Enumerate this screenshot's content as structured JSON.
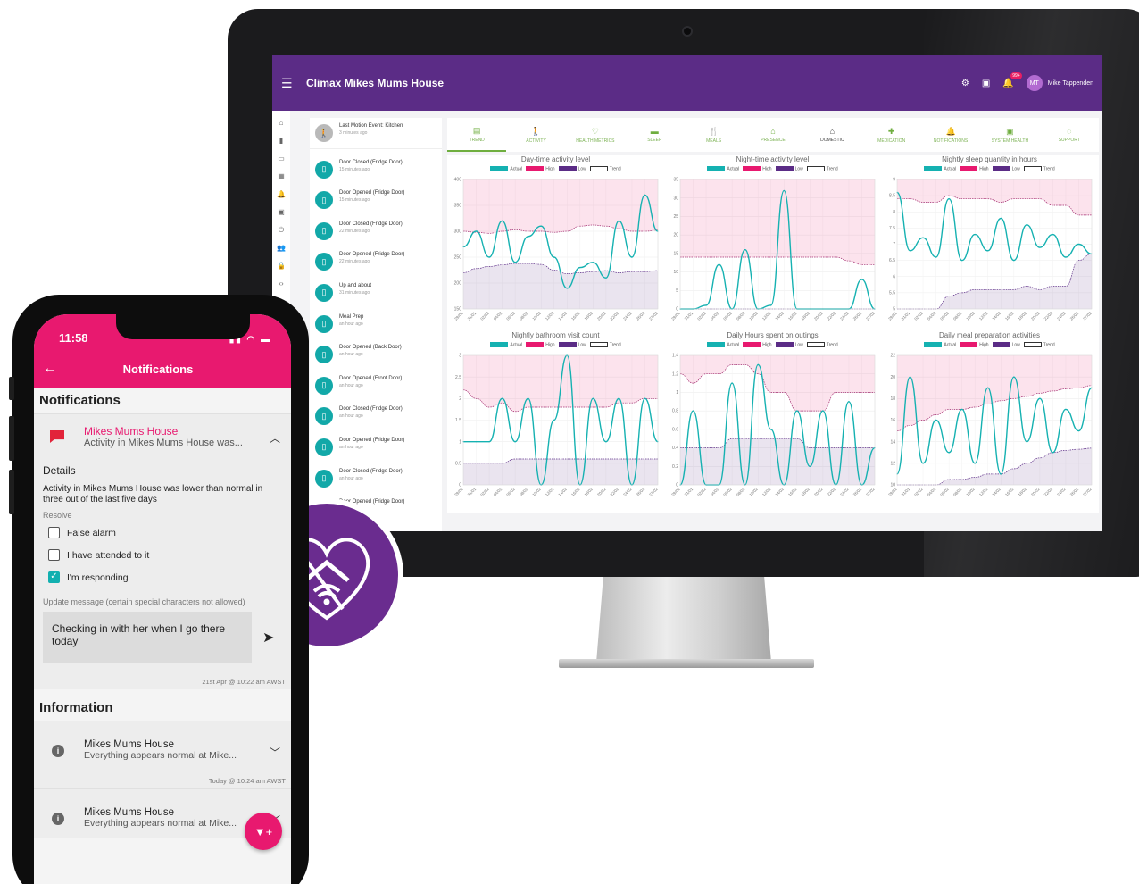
{
  "dashboard": {
    "app_title": "Climax Mikes Mums House",
    "notif_badge": "99+",
    "user_initials": "MT",
    "user_name": "Mike Tappenden",
    "events": [
      {
        "label": "Last Motion Event: Kitchen",
        "time": "3 minutes ago"
      },
      {
        "label": "Door Closed (Fridge Door)",
        "time": "15 minutes ago"
      },
      {
        "label": "Door Opened (Fridge Door)",
        "time": "15 minutes ago"
      },
      {
        "label": "Door Closed (Fridge Door)",
        "time": "22 minutes ago"
      },
      {
        "label": "Door Opened (Fridge Door)",
        "time": "22 minutes ago"
      },
      {
        "label": "Up and about",
        "time": "31 minutes ago"
      },
      {
        "label": "Meal Prep",
        "time": "an hour ago"
      },
      {
        "label": "Door Opened (Back Door)",
        "time": "an hour ago"
      },
      {
        "label": "Door Opened (Front Door)",
        "time": "an hour ago"
      },
      {
        "label": "Door Closed (Fridge Door)",
        "time": "an hour ago"
      },
      {
        "label": "Door Opened (Fridge Door)",
        "time": "an hour ago"
      },
      {
        "label": "Door Closed (Fridge Door)",
        "time": "an hour ago"
      },
      {
        "label": "Door Opened (Fridge Door)",
        "time": ""
      }
    ],
    "tabs": [
      {
        "label": "TREND",
        "icon": "▤"
      },
      {
        "label": "ACTIVITY",
        "icon": "🚶"
      },
      {
        "label": "HEALTH METRICS",
        "icon": "♡"
      },
      {
        "label": "SLEEP",
        "icon": "▬"
      },
      {
        "label": "MEALS",
        "icon": "🍴"
      },
      {
        "label": "PRESENCE",
        "icon": "⌂"
      },
      {
        "label": "DOMESTIC",
        "icon": "⌂"
      },
      {
        "label": "MEDICATION",
        "icon": "✚"
      },
      {
        "label": "NOTIFICATIONS",
        "icon": "🔔"
      },
      {
        "label": "SYSTEM HEALTH",
        "icon": "▣"
      },
      {
        "label": "SUPPORT",
        "icon": "◌"
      }
    ],
    "legend": [
      "Actual",
      "High",
      "Low",
      "Trend"
    ],
    "colors": {
      "actual": "#15b1b1",
      "high": "#e8196f",
      "low": "#5b2c86",
      "purple": "#5b2c86",
      "pink": "#e8196f"
    }
  },
  "chart_data": [
    {
      "type": "line",
      "title": "Day-time activity level",
      "ylim": [
        150,
        400
      ],
      "yticks": [
        150,
        200,
        250,
        300,
        350,
        400
      ],
      "x": [
        "29/01",
        "31/01",
        "02/02",
        "04/02",
        "06/02",
        "08/02",
        "10/02",
        "12/02",
        "14/02",
        "16/02",
        "18/02",
        "20/02",
        "22/02",
        "24/02",
        "26/02",
        "27/02"
      ],
      "series": [
        {
          "name": "Actual",
          "values": [
            270,
            300,
            250,
            320,
            240,
            290,
            310,
            250,
            190,
            230,
            240,
            210,
            320,
            250,
            370,
            300
          ]
        },
        {
          "name": "High",
          "values": [
            300,
            298,
            296,
            300,
            303,
            300,
            300,
            298,
            300,
            310,
            312,
            310,
            305,
            300,
            300,
            302
          ]
        },
        {
          "name": "Low",
          "values": [
            220,
            228,
            232,
            235,
            238,
            238,
            236,
            225,
            218,
            220,
            222,
            224,
            220,
            222,
            222,
            224
          ]
        }
      ]
    },
    {
      "type": "line",
      "title": "Night-time activity level",
      "ylim": [
        0,
        35
      ],
      "yticks": [
        0,
        5,
        10,
        15,
        20,
        25,
        30,
        35
      ],
      "x": [
        "29/01",
        "31/01",
        "02/02",
        "04/02",
        "06/02",
        "08/02",
        "10/02",
        "12/02",
        "14/02",
        "16/02",
        "18/02",
        "20/02",
        "22/02",
        "24/02",
        "26/02",
        "27/02"
      ],
      "series": [
        {
          "name": "Actual",
          "values": [
            0,
            0,
            1,
            12,
            0,
            16,
            0,
            1,
            32,
            0,
            0,
            0,
            0,
            0,
            8,
            0
          ]
        },
        {
          "name": "High",
          "values": [
            14,
            14,
            14,
            14,
            14,
            14,
            14,
            14,
            14,
            14,
            14,
            14,
            14,
            13,
            12,
            12
          ]
        },
        {
          "name": "Low",
          "values": [
            0,
            0,
            0,
            0,
            0,
            0,
            0,
            0,
            0,
            0,
            0,
            0,
            0,
            0,
            0,
            0
          ]
        }
      ]
    },
    {
      "type": "line",
      "title": "Nightly sleep quantity in hours",
      "ylim": [
        5.0,
        9.0
      ],
      "yticks": [
        5.0,
        5.5,
        6.0,
        6.5,
        7.0,
        7.5,
        8.0,
        8.5,
        9.0
      ],
      "x": [
        "29/01",
        "31/01",
        "02/02",
        "04/02",
        "06/02",
        "08/02",
        "10/02",
        "12/02",
        "14/02",
        "16/02",
        "18/02",
        "20/02",
        "22/02",
        "24/02",
        "26/02",
        "27/02"
      ],
      "series": [
        {
          "name": "Actual",
          "values": [
            8.6,
            6.8,
            7.2,
            6.6,
            8.4,
            6.5,
            7.3,
            6.8,
            7.8,
            6.5,
            7.6,
            6.9,
            7.3,
            6.6,
            7.0,
            6.7
          ]
        },
        {
          "name": "High",
          "values": [
            8.4,
            8.4,
            8.3,
            8.3,
            8.5,
            8.4,
            8.4,
            8.4,
            8.3,
            8.4,
            8.4,
            8.4,
            8.2,
            8.2,
            7.9,
            7.9
          ]
        },
        {
          "name": "Low",
          "values": [
            5.0,
            5.0,
            5.0,
            5.0,
            5.4,
            5.5,
            5.6,
            5.6,
            5.6,
            5.6,
            5.7,
            5.6,
            5.7,
            5.7,
            6.5,
            6.7
          ]
        }
      ]
    },
    {
      "type": "line",
      "title": "Nightly bathroom visit count",
      "ylim": [
        0,
        3.0
      ],
      "yticks": [
        0,
        0.5,
        1.0,
        1.5,
        2.0,
        2.5,
        3.0
      ],
      "x": [
        "29/01",
        "31/01",
        "02/02",
        "04/02",
        "06/02",
        "08/02",
        "10/02",
        "12/02",
        "14/02",
        "16/02",
        "18/02",
        "20/02",
        "22/02",
        "24/02",
        "26/02",
        "27/02"
      ],
      "series": [
        {
          "name": "Actual",
          "values": [
            1.0,
            1.0,
            1.0,
            2.0,
            1.0,
            2.0,
            0.0,
            1.5,
            3.0,
            0.0,
            2.0,
            1.0,
            2.0,
            0.0,
            2.0,
            1.0
          ]
        },
        {
          "name": "High",
          "values": [
            2.2,
            2.0,
            1.8,
            1.9,
            1.7,
            1.8,
            1.8,
            1.8,
            1.8,
            1.8,
            1.8,
            1.8,
            1.9,
            1.9,
            2.0,
            2.0
          ]
        },
        {
          "name": "Low",
          "values": [
            0.5,
            0.5,
            0.5,
            0.5,
            0.6,
            0.6,
            0.6,
            0.6,
            0.6,
            0.6,
            0.6,
            0.6,
            0.6,
            0.6,
            0.6,
            0.6
          ]
        }
      ]
    },
    {
      "type": "line",
      "title": "Daily Hours spent on outings",
      "ylim": [
        0,
        1.4
      ],
      "yticks": [
        0,
        0.2,
        0.4,
        0.6,
        0.8,
        1.0,
        1.2,
        1.4
      ],
      "x": [
        "29/01",
        "31/01",
        "02/02",
        "04/02",
        "06/02",
        "08/02",
        "10/02",
        "12/02",
        "14/02",
        "16/02",
        "18/02",
        "20/02",
        "22/02",
        "24/02",
        "26/02",
        "27/02"
      ],
      "series": [
        {
          "name": "Actual",
          "values": [
            0.0,
            0.8,
            0.0,
            0.0,
            1.1,
            0.0,
            1.3,
            0.6,
            0.0,
            0.8,
            0.2,
            0.8,
            0.0,
            0.9,
            0.0,
            0.4
          ]
        },
        {
          "name": "High",
          "values": [
            1.2,
            1.1,
            1.2,
            1.2,
            1.3,
            1.3,
            1.2,
            1.0,
            1.0,
            0.8,
            0.8,
            0.8,
            1.0,
            1.0,
            1.0,
            1.0
          ]
        },
        {
          "name": "Low",
          "values": [
            0.4,
            0.4,
            0.4,
            0.4,
            0.5,
            0.5,
            0.5,
            0.5,
            0.5,
            0.5,
            0.4,
            0.4,
            0.4,
            0.4,
            0.4,
            0.4
          ]
        }
      ]
    },
    {
      "type": "line",
      "title": "Daily meal preparation activities",
      "ylim": [
        10,
        22
      ],
      "yticks": [
        10,
        12,
        14,
        16,
        18,
        20,
        22
      ],
      "x": [
        "29/01",
        "31/01",
        "02/02",
        "04/02",
        "06/02",
        "08/02",
        "10/02",
        "12/02",
        "14/02",
        "16/02",
        "18/02",
        "20/02",
        "22/02",
        "24/02",
        "26/02",
        "27/02"
      ],
      "series": [
        {
          "name": "Actual",
          "values": [
            11,
            20,
            12,
            16,
            13,
            17,
            12,
            19,
            11,
            20,
            14,
            18,
            13,
            17,
            15,
            19
          ]
        },
        {
          "name": "High",
          "values": [
            15,
            15.5,
            16,
            16.5,
            17,
            17,
            17.2,
            17.5,
            17.8,
            18,
            18.2,
            18.5,
            18.7,
            18.9,
            19,
            19.2
          ]
        },
        {
          "name": "Low",
          "values": [
            10,
            10,
            10,
            10,
            10.5,
            10.5,
            10.7,
            11,
            11,
            11.5,
            12,
            12.5,
            13,
            13.2,
            13.3,
            13.4
          ]
        }
      ]
    }
  ],
  "phone": {
    "time": "11:58",
    "title": "Notifications",
    "section_notifications": "Notifications",
    "notif": {
      "title": "Mikes Mums House",
      "subtitle": "Activity in Mikes Mums House was..."
    },
    "details_heading": "Details",
    "details_text": "Activity in Mikes Mums House was lower than normal in three out of the last five days",
    "resolve_label": "Resolve",
    "options": [
      {
        "label": "False alarm",
        "checked": false
      },
      {
        "label": "I have attended to it",
        "checked": false
      },
      {
        "label": "I'm responding",
        "checked": true
      }
    ],
    "update_label": "Update message (certain special characters not allowed)",
    "message": "Checking in with her when I go there today",
    "message_stamp": "21st Apr @ 10:22 am AWST",
    "section_information": "Information",
    "info": [
      {
        "title": "Mikes Mums House",
        "subtitle": "Everything appears normal at Mike...",
        "stamp": "Today @ 10:24 am AWST"
      },
      {
        "title": "Mikes Mums House",
        "subtitle": "Everything appears normal at Mike...",
        "stamp": ""
      }
    ]
  }
}
